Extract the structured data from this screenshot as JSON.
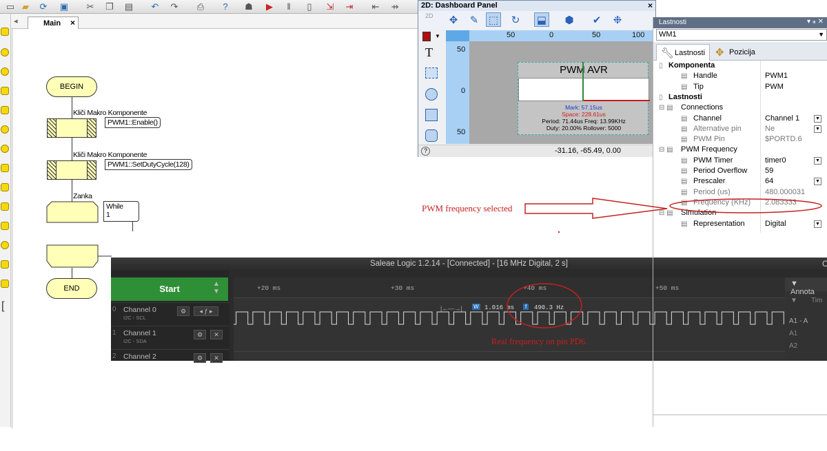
{
  "flowcode": {
    "tab_label": "Main",
    "tab_close": "×",
    "tab_arrow": "◂",
    "begin": "BEGIN",
    "end": "END",
    "macro1_caption": "Kliči Makro Komponente",
    "macro1_call": "PWM1::Enable()",
    "macro2_caption": "Kliči Makro Komponente",
    "macro2_call": "PWM1::SetDutyCycle(128)",
    "loop_caption": "Zanka",
    "loop_cond_1": "While",
    "loop_cond_2": "1"
  },
  "dashboard": {
    "title": "2D: Dashboard Panel",
    "close": "×",
    "pwm_title": "PWM AVR",
    "mark": "Mark: 57.15us",
    "space": "Space: 228.61us",
    "period_freq": "Period: 71.44us   Freq: 13.99KHz",
    "duty_rollover": "Duty: 20.00%   Rollover: 5000",
    "coords": "-31.16, -65.49, 0.00",
    "ruler_x": [
      "50",
      "0",
      "50",
      "100"
    ],
    "ruler_y": [
      "50",
      "0",
      "50"
    ],
    "label_2d": "2D",
    "text_tool": "T"
  },
  "properties": {
    "title": "Lastnosti",
    "selected": "WM1",
    "tab_properties": "Lastnosti",
    "tab_position": "Pozicija",
    "rows": [
      {
        "name": "Komponenta",
        "value": "",
        "type": "cat"
      },
      {
        "name": "Handle",
        "value": "PWM1",
        "type": "row"
      },
      {
        "name": "Tip",
        "value": "PWM",
        "type": "row"
      },
      {
        "name": "Lastnosti",
        "value": "",
        "type": "cat"
      },
      {
        "name": "Connections",
        "value": "",
        "type": "group"
      },
      {
        "name": "Channel",
        "value": "Channel 1",
        "type": "row",
        "dd": true
      },
      {
        "name": "Alternative pin",
        "value": "Ne",
        "type": "muted",
        "dd": true
      },
      {
        "name": "PWM Pin",
        "value": "$PORTD.6",
        "type": "muted"
      },
      {
        "name": "PWM Frequency",
        "value": "",
        "type": "group"
      },
      {
        "name": "PWM Timer",
        "value": "timer0",
        "type": "row",
        "dd": true
      },
      {
        "name": "Period Overflow",
        "value": "59",
        "type": "row"
      },
      {
        "name": "Prescaler",
        "value": "64",
        "type": "row",
        "dd": true
      },
      {
        "name": "Period (us)",
        "value": "480.000031",
        "type": "muted"
      },
      {
        "name": "Frequency (KHz)",
        "value": "2.083333",
        "type": "muted"
      },
      {
        "name": "Simulation",
        "value": "",
        "type": "group"
      },
      {
        "name": "Representation",
        "value": "Digital",
        "type": "row",
        "dd": true
      }
    ]
  },
  "annotations": {
    "pwm_selected": "PWM frequency selected",
    "real_freq": "Real frequency on pin PD6."
  },
  "logic": {
    "title": "Saleae Logic 1.2.14 - [Connected] - [16 MHz Digital, 2 s]",
    "start": "Start",
    "channels": [
      {
        "name": "Channel 0",
        "sub": "I2C - SCL"
      },
      {
        "name": "Channel 1",
        "sub": "I2C - SDA"
      },
      {
        "name": "Channel 2",
        "sub": ""
      }
    ],
    "ticks": [
      "+20 ms",
      "+30 ms",
      "+40 ms",
      "+50 ms"
    ],
    "width_label": "W",
    "width_value": "1.016 ms",
    "freq_label": "f",
    "freq_value": "490.3 Hz",
    "annotations_title": "Annota",
    "ann_time": "Tim",
    "ann_a1": "A1",
    "ann_a2": "A2",
    "ann_a1_tag": "A1 - A",
    "channel_indices": [
      "0",
      "1",
      "2"
    ],
    "right_edge": "C"
  },
  "colors": {
    "annotation_red": "#c62020",
    "start_green": "#2f8f36",
    "flow_fill": "#ffffb8"
  }
}
